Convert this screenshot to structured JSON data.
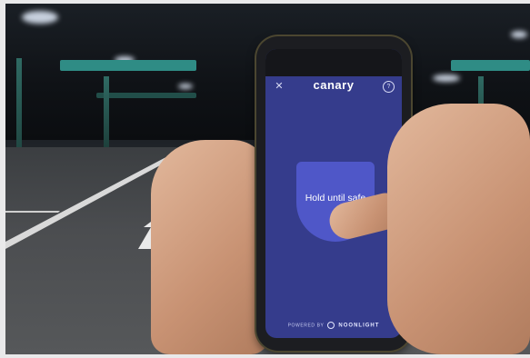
{
  "app": {
    "logo": "canary",
    "close_icon": "close-icon",
    "help_icon": "help-icon",
    "hold_button_label": "Hold until safe",
    "footer_prefix": "POWERED BY",
    "footer_brand": "NOONLIGHT",
    "colors": {
      "screen_bg": "#353c8c",
      "button": "#4f57c8",
      "text": "#ffffff"
    }
  },
  "scene": {
    "setting": "dark parking garage"
  }
}
